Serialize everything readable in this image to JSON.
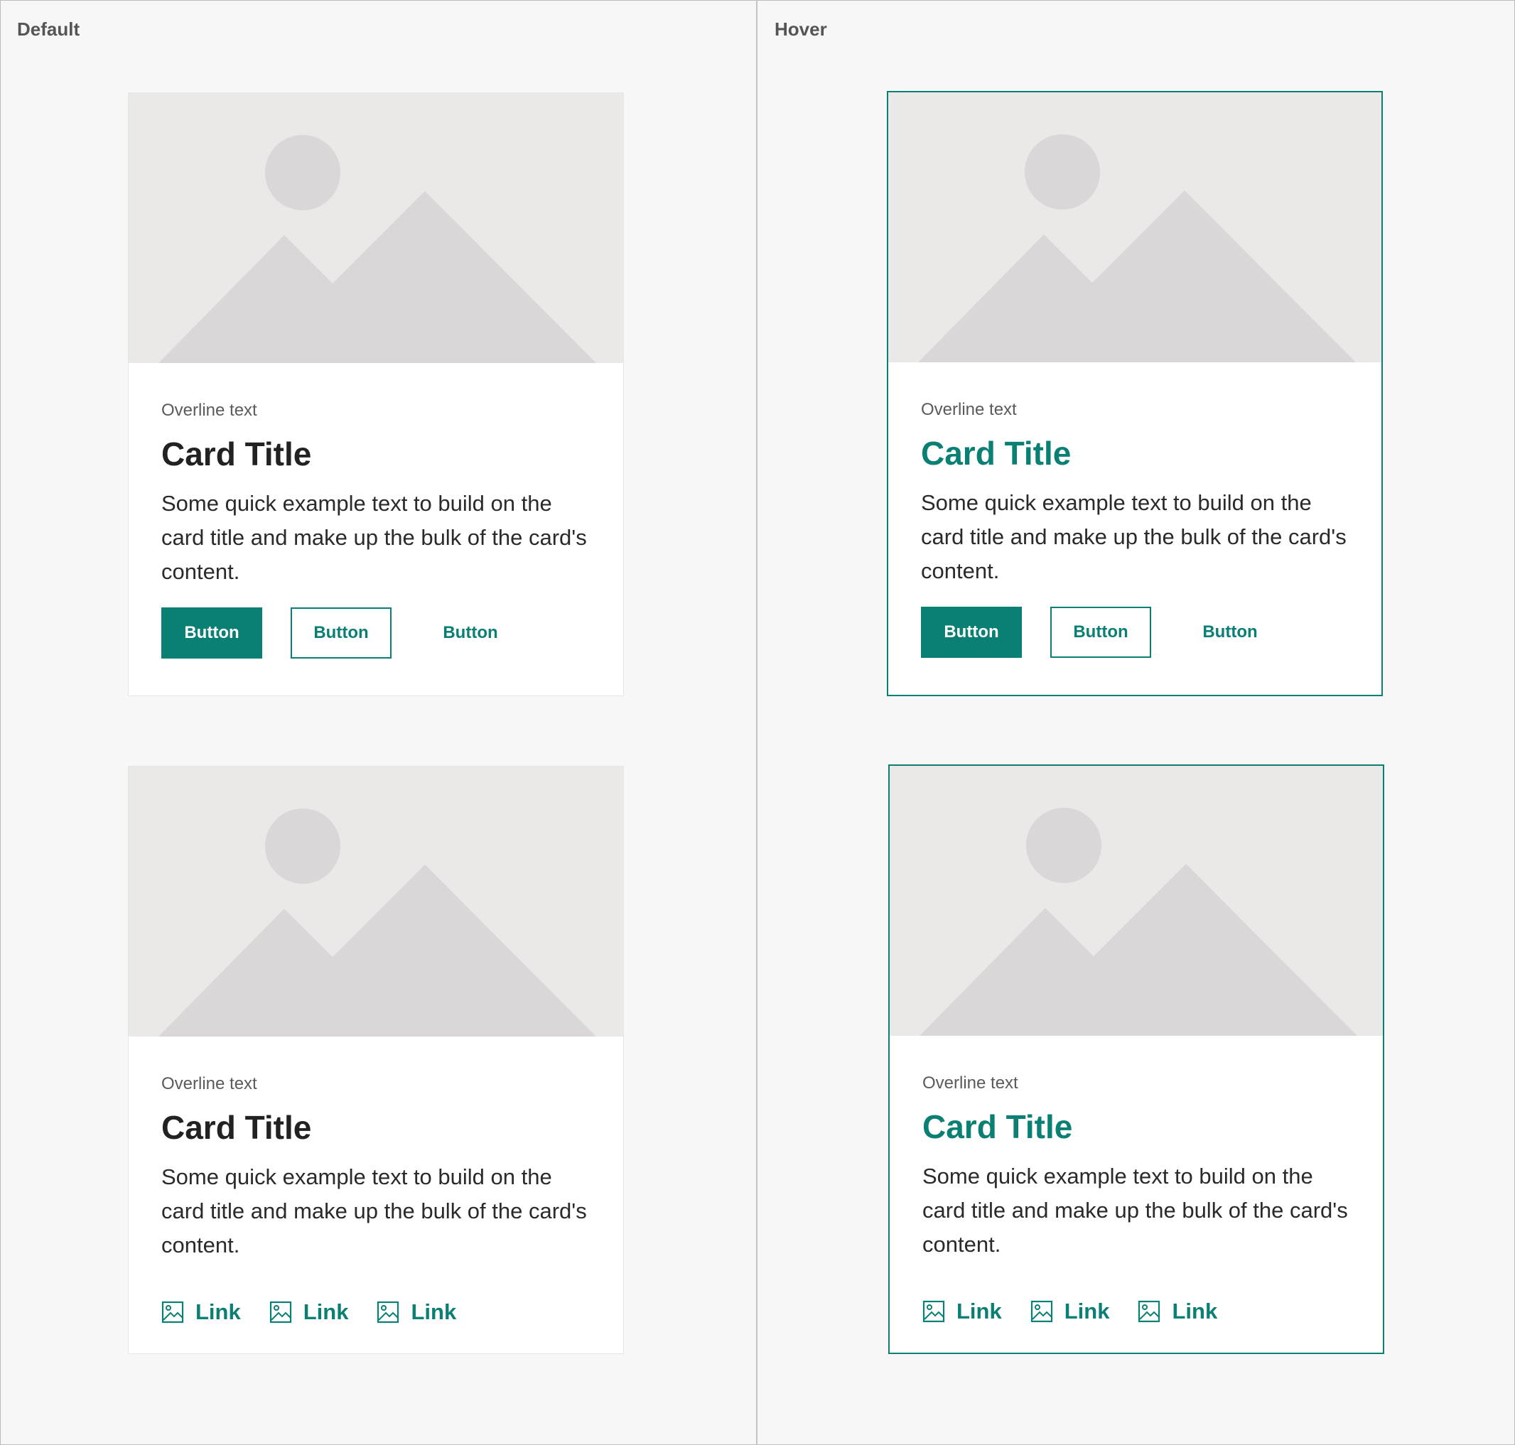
{
  "columns": {
    "default_label": "Default",
    "hover_label": "Hover"
  },
  "colors": {
    "accent": "#0a7f73",
    "placeholder_bg": "#ebe8e8",
    "placeholder_shape": "#dbd6d7"
  },
  "cards": {
    "default_buttons": {
      "overline": "Overline text",
      "title": "Card Title",
      "text": "Some quick example text to build on the card title and make up the bulk of the card's content.",
      "primary": "Button",
      "outline": "Button",
      "text_button": "Button"
    },
    "hover_buttons": {
      "overline": "Overline text",
      "title": "Card Title",
      "text": "Some quick example text to build on the card title and make up the bulk of the card's content.",
      "primary": "Button",
      "outline": "Button",
      "text_button": "Button"
    },
    "default_links": {
      "overline": "Overline text",
      "title": "Card Title",
      "text": "Some quick example text to build on the card title and make up the bulk of the card's content.",
      "links": [
        "Link",
        "Link",
        "Link"
      ],
      "link_icon": "image-icon"
    },
    "hover_links": {
      "overline": "Overline text",
      "title": "Card Title",
      "text": "Some quick example text to build on the card title and make up the bulk of the card's content.",
      "links": [
        "Link",
        "Link",
        "Link"
      ],
      "link_icon": "image-icon"
    }
  }
}
